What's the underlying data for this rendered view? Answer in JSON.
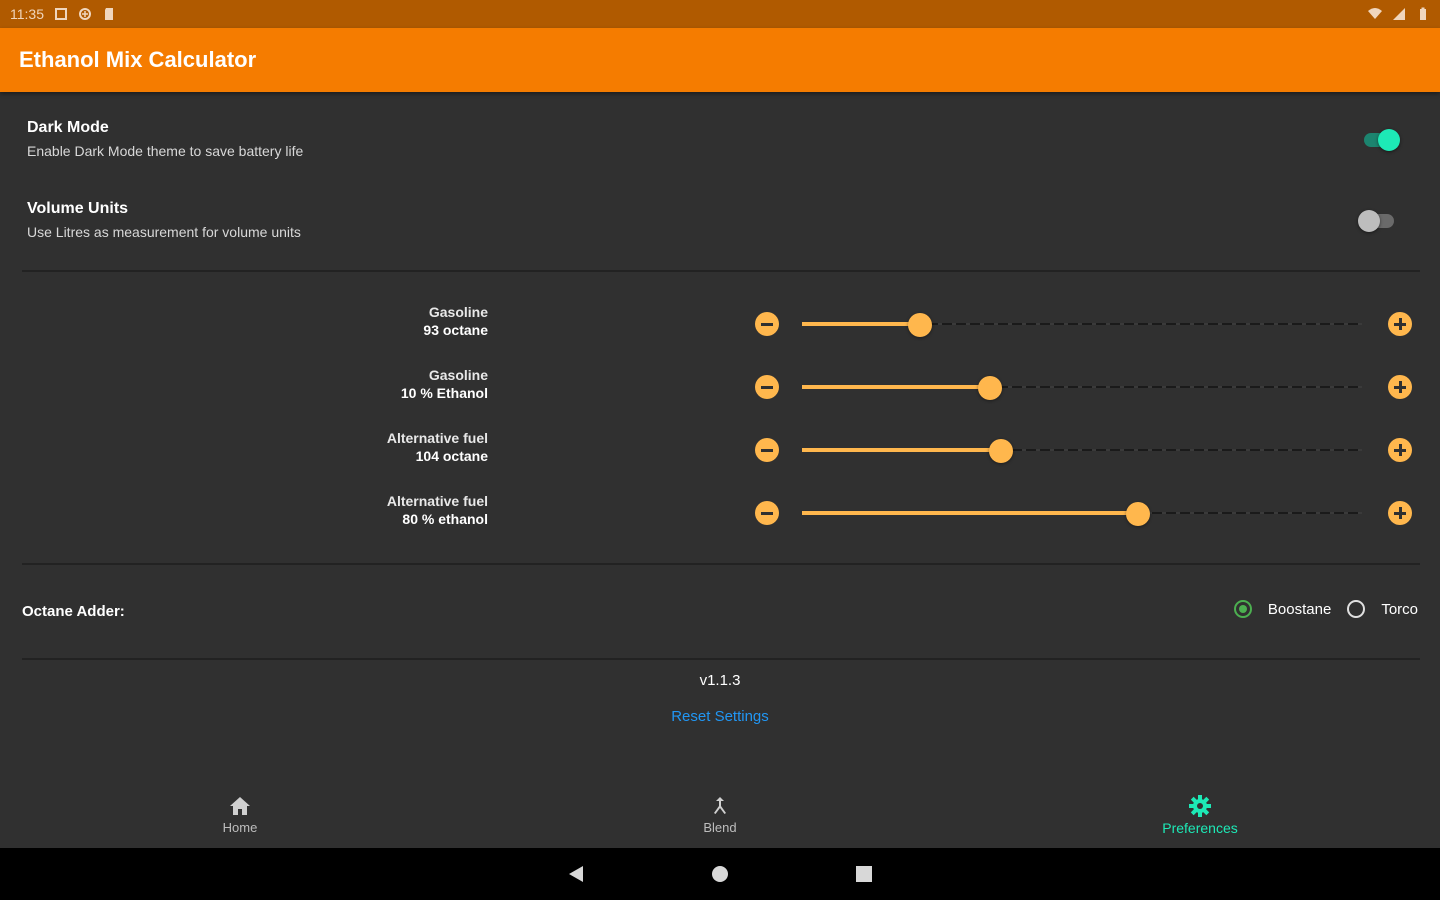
{
  "status": {
    "time": "11:35",
    "icons": [
      "square-notification-icon",
      "data-saver-icon",
      "sd-card-icon"
    ],
    "right_icons": [
      "wifi-icon",
      "signal-icon",
      "battery-icon"
    ]
  },
  "app": {
    "title": "Ethanol Mix Calculator",
    "accent": "#f57c00"
  },
  "prefs": {
    "dark_mode": {
      "title": "Dark Mode",
      "summary": "Enable Dark Mode theme to save battery life",
      "on": true
    },
    "volume_units": {
      "title": "Volume Units",
      "summary": "Use Litres as measurement for volume units",
      "on": false
    }
  },
  "sliders": [
    {
      "line1": "Gasoline",
      "line2": "93 octane",
      "level": 0.21
    },
    {
      "line1": "Gasoline",
      "line2": "10 % Ethanol",
      "level": 0.335
    },
    {
      "line1": "Alternative fuel",
      "line2": "104 octane",
      "level": 0.355
    },
    {
      "line1": "Alternative fuel",
      "line2": "80 % ethanol",
      "level": 0.6
    }
  ],
  "octane_adder": {
    "label": "Octane Adder:",
    "options": [
      {
        "label": "Boostane",
        "selected": true
      },
      {
        "label": "Torco",
        "selected": false
      }
    ]
  },
  "footer": {
    "version": "v1.1.3",
    "reset": "Reset Settings"
  },
  "nav": {
    "items": [
      {
        "label": "Home",
        "icon": "home-icon",
        "active": false
      },
      {
        "label": "Blend",
        "icon": "merge-icon",
        "active": false
      },
      {
        "label": "Preferences",
        "icon": "gear-icon",
        "active": true
      }
    ]
  },
  "colors": {
    "slider": "#ffb74d",
    "switch_on": "#1de9b6",
    "radio_selected": "#4caf50",
    "link": "#2196f3"
  }
}
